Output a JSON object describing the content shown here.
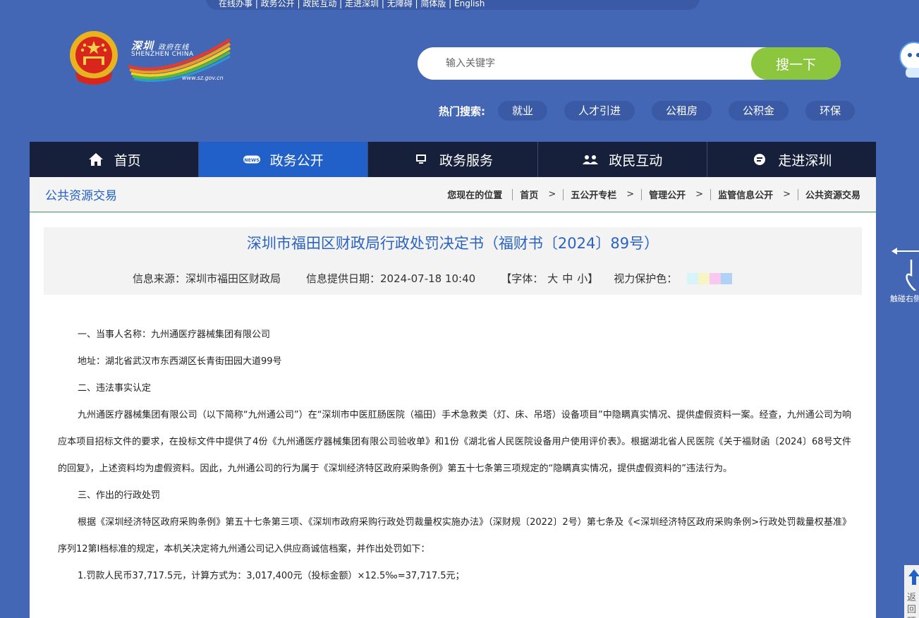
{
  "top_strip": "在线办事 | 政务公开 | 政民互动 | 走进深圳 | 无障碍 | 简体版 | English",
  "brand": {
    "cn": "深圳",
    "cn_small": "政府在线",
    "en": "SHENZHEN CHINA",
    "url": "www.sz.gov.cn"
  },
  "search": {
    "placeholder": "输入关键字",
    "value": "",
    "button": "搜一下"
  },
  "hot": {
    "label": "热门搜索:",
    "tags": [
      "就业",
      "人才引进",
      "公租房",
      "公积金",
      "环保"
    ]
  },
  "side": {
    "touch_label": "触碰右侧",
    "backtop_label": "返回顶部"
  },
  "nav": [
    {
      "label": "首页",
      "icon": "home-icon"
    },
    {
      "label": "政务公开",
      "icon": "news-icon"
    },
    {
      "label": "政务服务",
      "icon": "monitor-icon"
    },
    {
      "label": "政民互动",
      "icon": "people-icon"
    },
    {
      "label": "走进深圳",
      "icon": "chat-icon"
    }
  ],
  "section_title": "公共资源交易",
  "breadcrumb": {
    "lead": "您现在的位置",
    "items": [
      "首页",
      "五公开专栏",
      "管理公开",
      "监管信息公开",
      "公共资源交易"
    ]
  },
  "doc": {
    "title": "深圳市福田区财政局行政处罚决定书（福财书〔2024〕89号）",
    "source": "信息来源：深圳市福田区财政局",
    "date": "信息提供日期：2024-07-18 10:40",
    "font_label": "【字体：",
    "font_sizes": [
      "大",
      "中",
      "小"
    ],
    "font_close": "】",
    "eye_label": "视力保护色：",
    "eye_colors": [
      "#d6f5fa",
      "#f7f5c4",
      "#f9c8f0",
      "#b0d2f5"
    ]
  },
  "paragraphs": [
    "一、当事人名称：九州通医疗器械集团有限公司",
    "地址：湖北省武汉市东西湖区长青街田园大道99号",
    "二、违法事实认定",
    "九州通医疗器械集团有限公司（以下简称“九州通公司”）在“深圳市中医肛肠医院（福田）手术急救类（灯、床、吊塔）设备项目”中隐瞒真实情况、提供虚假资料一案。经查，九州通公司为响应本项目招标文件的要求，在投标文件中提供了4份《九州通医疗器械集团有限公司验收单》和1份《湖北省人民医院设备用户使用评价表》。根据湖北省人民医院《关于福财函〔2024〕68号文件的回复》，上述资料均为虚假资料。因此，九州通公司的行为属于《深圳经济特区政府采购条例》第五十七条第三项规定的“隐瞒真实情况，提供虚假资料的”违法行为。",
    "三、作出的行政处罚",
    "根据《深圳经济特区政府采购条例》第五十七条第三项、《深圳市政府采购行政处罚裁量权实施办法》（深财规〔2022〕2号）第七条及《<深圳经济特区政府采购条例>行政处罚裁量权基准》序列12第Ⅰ档标准的规定，本机关决定将九州通公司记入供应商诚信档案，并作出处罚如下：",
    "1.罚款人民币37,717.5元，计算方式为：3,017,400元（投标金额）×12.5‰=37,717.5元；"
  ]
}
